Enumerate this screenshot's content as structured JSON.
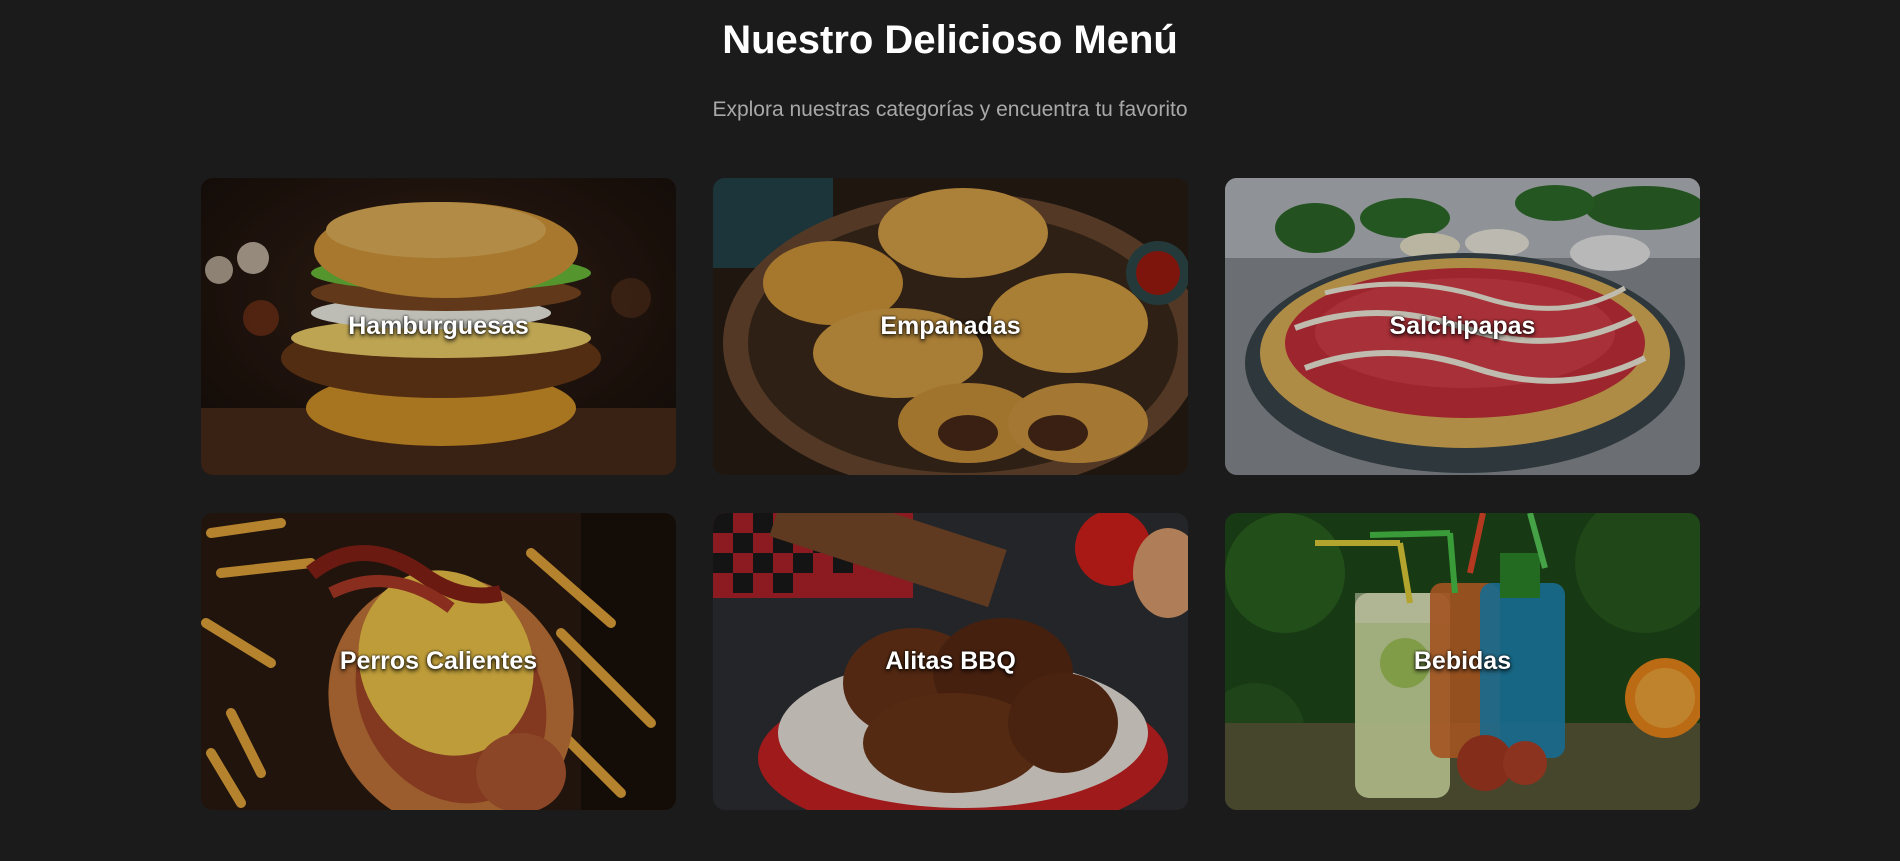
{
  "header": {
    "title": "Nuestro Delicioso Menú",
    "subtitle": "Explora nuestras categorías y encuentra tu favorito"
  },
  "categories": [
    {
      "label": "Hamburguesas",
      "image": "burger-image"
    },
    {
      "label": "Empanadas",
      "image": "empanadas-image"
    },
    {
      "label": "Salchipapas",
      "image": "salchipapas-image"
    },
    {
      "label": "Perros Calientes",
      "image": "hotdog-image"
    },
    {
      "label": "Alitas BBQ",
      "image": "bbq-wings-image"
    },
    {
      "label": "Bebidas",
      "image": "drinks-image"
    }
  ],
  "colors": {
    "background": "#1b1b1b",
    "title": "#ffffff",
    "subtitle": "#a8a8a8"
  }
}
